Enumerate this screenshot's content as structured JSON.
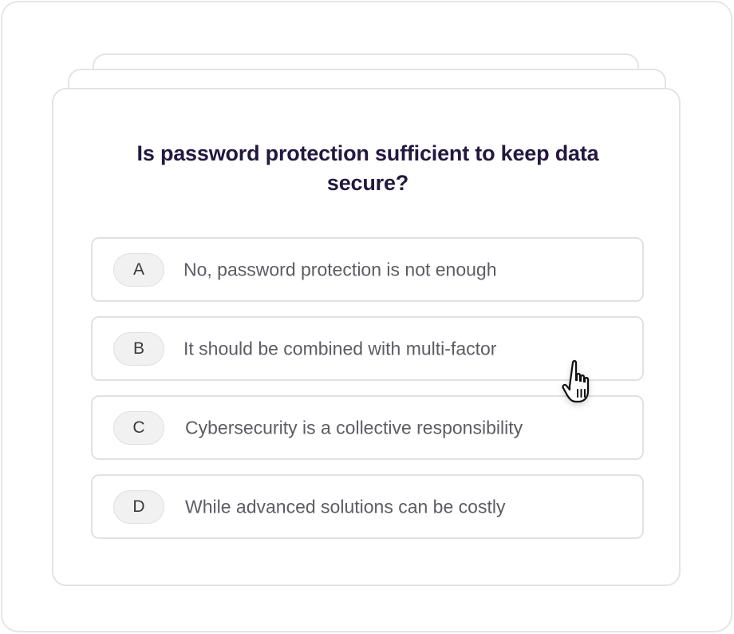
{
  "quiz": {
    "question": "Is password protection sufficient to keep data secure?",
    "options": [
      {
        "letter": "A",
        "text": "No, password protection is not enough"
      },
      {
        "letter": "B",
        "text": "It should be combined with multi-factor"
      },
      {
        "letter": "C",
        "text": "Cybersecurity is a collective responsibility"
      },
      {
        "letter": "D",
        "text": "While advanced solutions can be costly"
      }
    ]
  },
  "cursor": {
    "icon": "hand-pointer-icon"
  },
  "colors": {
    "question_text": "#23183f",
    "option_text": "#5c5c64",
    "border": "#e2e2e2",
    "badge_bg": "#f1f1f1"
  }
}
